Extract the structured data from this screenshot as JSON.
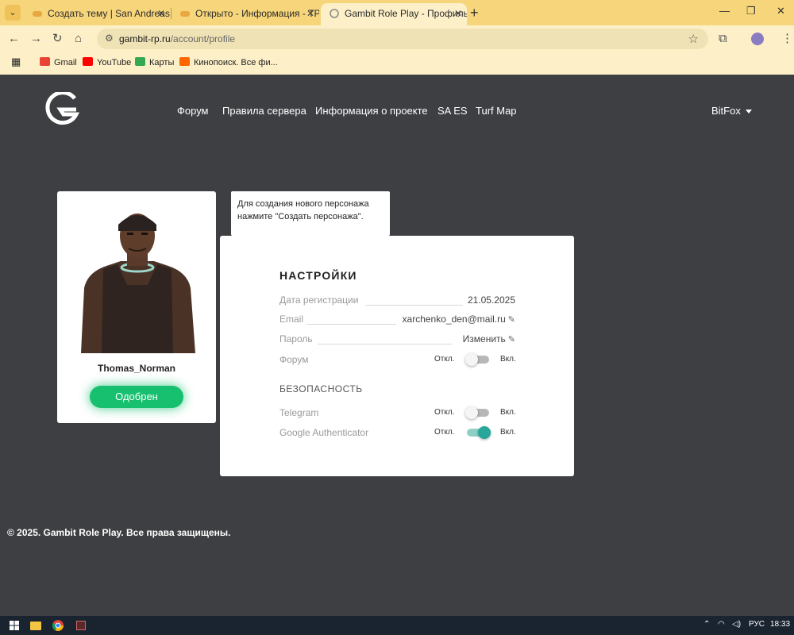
{
  "browser": {
    "tabs": [
      {
        "title": "Создать тему | San Andreas Em"
      },
      {
        "title": "Открыто - Информация - ТРЕБ"
      },
      {
        "title": "Gambit Role Play - Профиль U"
      }
    ],
    "url_host": "gambit-rp.ru",
    "url_path": "/account/profile",
    "bookmarks": [
      {
        "label": "Gmail",
        "color": "#ea4335"
      },
      {
        "label": "YouTube",
        "color": "#ff0000"
      },
      {
        "label": "Карты",
        "color": "#34a853"
      },
      {
        "label": "Кинопоиск. Все фи...",
        "color": "#ff6600"
      }
    ]
  },
  "site": {
    "nav": [
      "Форум",
      "Правила сервера",
      "Информация о проекте",
      "SA ES",
      "Turf Map"
    ],
    "username": "BitFox",
    "brand_accent": "#17c06f"
  },
  "character": {
    "name": "Thomas_Norman",
    "status": "Одобрен"
  },
  "tooltip": {
    "line1": "Для создания нового персонажа",
    "line2": "нажмите \"Создать персонажа\"."
  },
  "settings": {
    "title": "НАСТРОЙКИ",
    "reg_label": "Дата регистрации",
    "reg_value": "21.05.2025",
    "email_label": "Email",
    "email_value": "xarchenko_den@mail.ru",
    "password_label": "Пароль",
    "password_action": "Изменить",
    "forum_label": "Форум",
    "forum_on": false,
    "security_title": "БЕЗОПАСНОСТЬ",
    "telegram_label": "Telegram",
    "telegram_on": false,
    "ga_label": "Google Authenticator",
    "ga_on": true,
    "off_label": "Откл.",
    "on_label": "Вкл."
  },
  "footer": {
    "text": "© 2025. Gambit Role Play. Все права защищены."
  },
  "taskbar": {
    "lang": "РУС",
    "time": "18:33"
  }
}
